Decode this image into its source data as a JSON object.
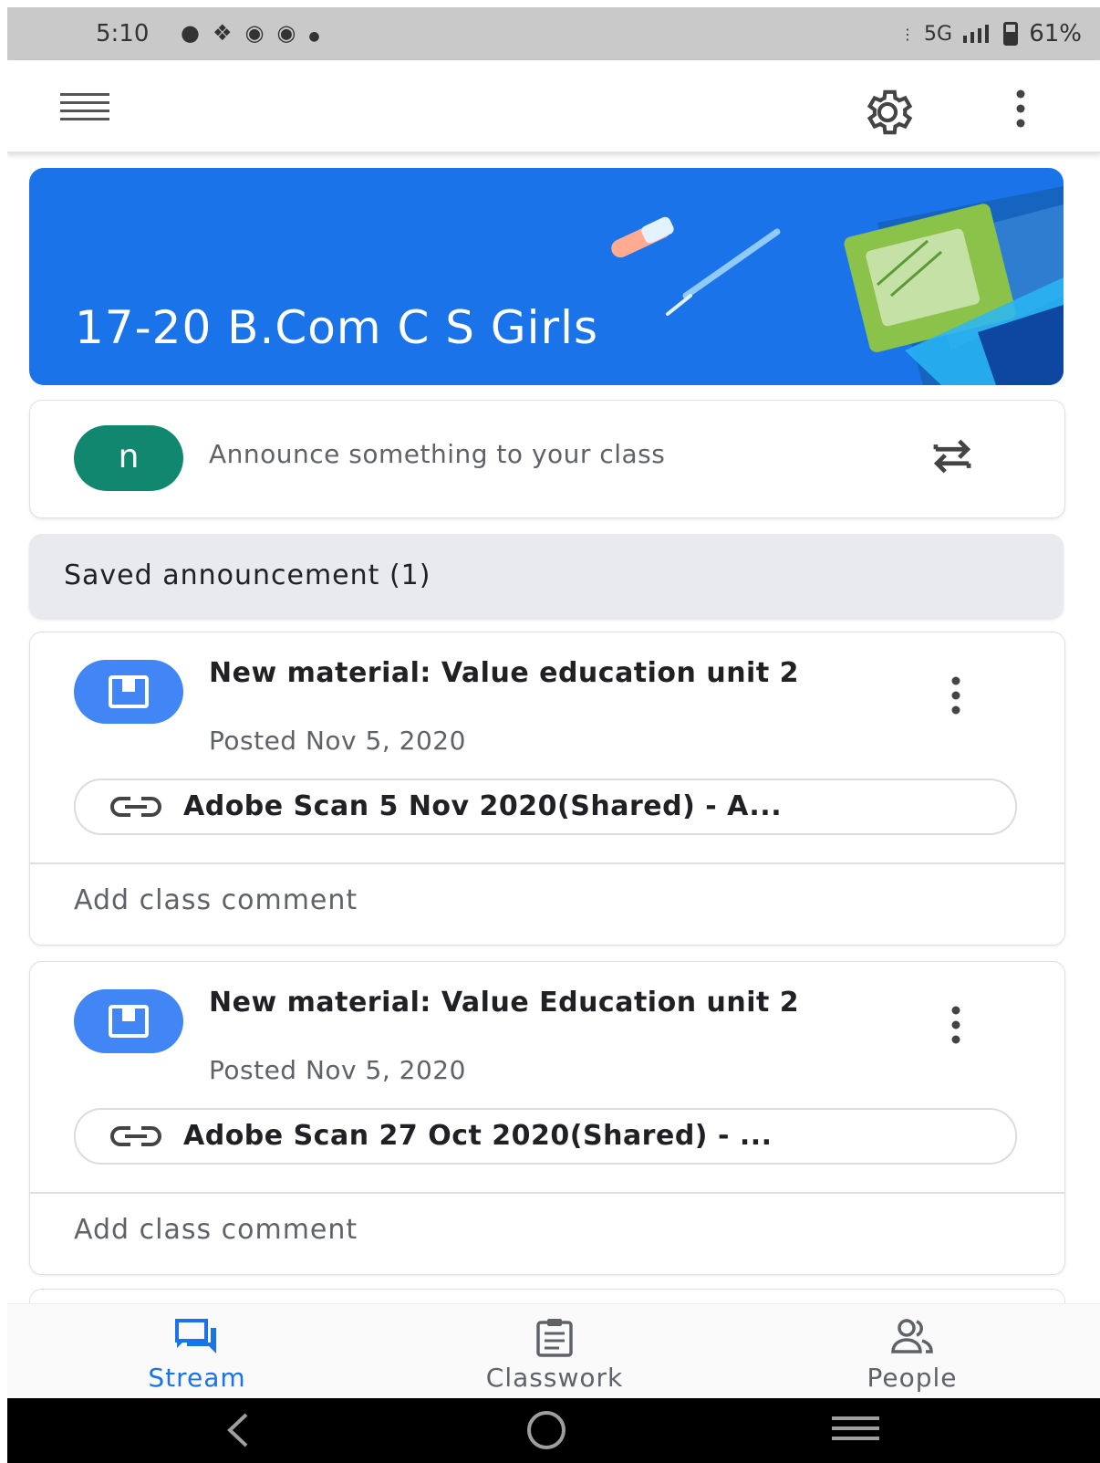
{
  "status_bar": {
    "time": "5:10",
    "network": "5G",
    "battery": "61%"
  },
  "banner": {
    "class_name": "17-20 B.Com C S Girls"
  },
  "announce": {
    "avatar_letter": "n",
    "placeholder": "Announce something to your class"
  },
  "saved": {
    "label": "Saved announcement (1)"
  },
  "posts": [
    {
      "title": "New material: Value education unit 2",
      "date": "Posted Nov 5, 2020",
      "attachment": "Adobe Scan 5 Nov 2020(Shared) - A...",
      "comment": "Add class comment"
    },
    {
      "title": "New material: Value Education unit 2",
      "date": "Posted Nov 5, 2020",
      "attachment": "Adobe Scan 27 Oct 2020(Shared) - ...",
      "comment": "Add class comment"
    }
  ],
  "bottom_nav": {
    "items": [
      {
        "label": "Stream",
        "icon": "stream-icon",
        "active": true
      },
      {
        "label": "Classwork",
        "icon": "classwork-icon",
        "active": false
      },
      {
        "label": "People",
        "icon": "people-icon",
        "active": false
      }
    ]
  },
  "colors": {
    "accent": "#1a73e8",
    "avatar": "#12876f",
    "material_icon": "#4285f4"
  }
}
